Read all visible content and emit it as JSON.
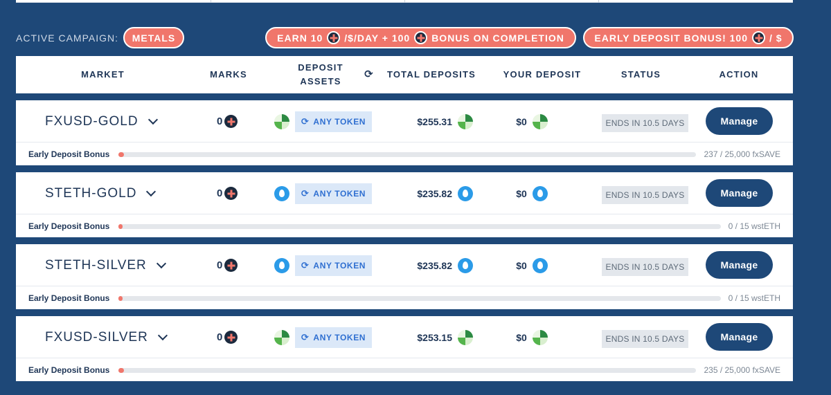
{
  "campaign": {
    "label": "ACTIVE CAMPAIGN:",
    "name": "METALS",
    "earn_prefix": "EARN 10",
    "earn_mid": "/$/DAY + 100",
    "earn_suffix": "BONUS ON COMPLETION",
    "early_prefix": "EARLY DEPOSIT BONUS!  100",
    "early_suffix": "/ $"
  },
  "table": {
    "headers": {
      "market": "MARKET",
      "marks": "MARKS",
      "deposit_line1": "DEPOSIT",
      "deposit_line2": "ASSETS",
      "total": "TOTAL DEPOSITS",
      "yours": "YOUR DEPOSIT",
      "status": "STATUS",
      "action": "ACTION"
    },
    "rows": [
      {
        "market": "FXUSD-GOLD",
        "marks": "0",
        "asset_icon": "fxsave-token",
        "any_token": "ANY TOKEN",
        "total": "$255.31",
        "yours": "$0",
        "status": "ENDS IN 10.5 DAYS",
        "action": "Manage",
        "bonus_label": "Early Deposit Bonus",
        "bonus_value": "237 / 25,000 fxSAVE",
        "bonus_progress": 0.0095
      },
      {
        "market": "STETH-GOLD",
        "marks": "0",
        "asset_icon": "wsteth-token",
        "any_token": "ANY TOKEN",
        "total": "$235.82",
        "yours": "$0",
        "status": "ENDS IN 10.5 DAYS",
        "action": "Manage",
        "bonus_label": "Early Deposit Bonus",
        "bonus_value": "0 / 15 wstETH",
        "bonus_progress": 0
      },
      {
        "market": "STETH-SILVER",
        "marks": "0",
        "asset_icon": "wsteth-token",
        "any_token": "ANY TOKEN",
        "total": "$235.82",
        "yours": "$0",
        "status": "ENDS IN 10.5 DAYS",
        "action": "Manage",
        "bonus_label": "Early Deposit Bonus",
        "bonus_value": "0 / 15 wstETH",
        "bonus_progress": 0
      },
      {
        "market": "FXUSD-SILVER",
        "marks": "0",
        "asset_icon": "fxsave-token",
        "any_token": "ANY TOKEN",
        "total": "$253.15",
        "yours": "$0",
        "status": "ENDS IN 10.5 DAYS",
        "action": "Manage",
        "bonus_label": "Early Deposit Bonus",
        "bonus_value": "235 / 25,000 fxSAVE",
        "bonus_progress": 0.0094
      }
    ]
  },
  "colors": {
    "background": "#1e4878",
    "accent": "#f0766b",
    "text": "#1e3556",
    "any_token_bg": "#dbe8f8",
    "any_token_text": "#2f6fd1"
  }
}
